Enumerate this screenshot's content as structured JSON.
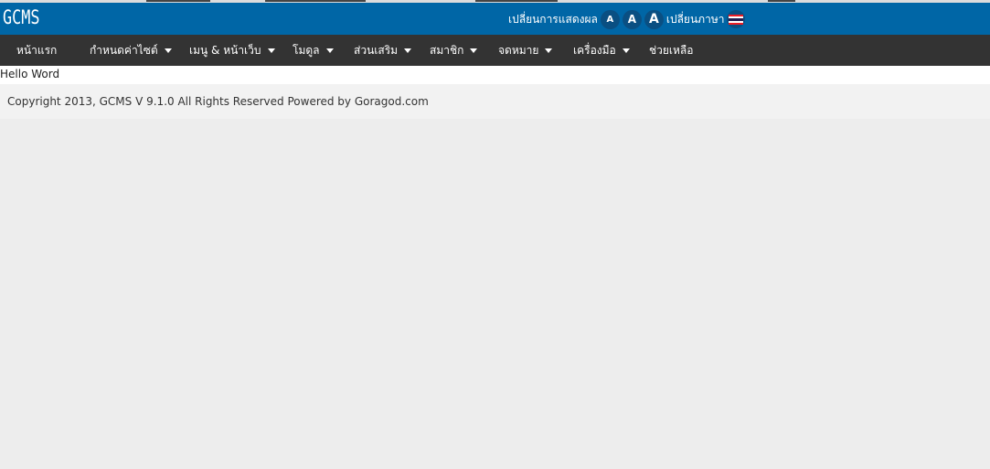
{
  "header": {
    "logo": "GCMS",
    "display_label": "เปลี่ยนการแสดงผล",
    "font_sizes": [
      "A",
      "A",
      "A"
    ],
    "language_label": "เปลี่ยนภาษา",
    "flag_icon": "thai-flag-icon",
    "colors": {
      "header_bg": "#0066a6",
      "nav_bg": "#333333"
    }
  },
  "nav": {
    "items": [
      {
        "label": "หน้าแรก",
        "dropdown": false
      },
      {
        "label": "กำหนดค่าไซต์",
        "dropdown": true
      },
      {
        "label": "เมนู & หน้าเว็บ",
        "dropdown": true
      },
      {
        "label": "โมดูล",
        "dropdown": true
      },
      {
        "label": "ส่วนเสริม",
        "dropdown": true
      },
      {
        "label": "สมาชิก",
        "dropdown": true
      },
      {
        "label": "จดหมาย",
        "dropdown": true
      },
      {
        "label": "เครื่องมือ",
        "dropdown": true
      },
      {
        "label": "ช่วยเหลือ",
        "dropdown": false
      }
    ]
  },
  "content": {
    "text": "Hello Word"
  },
  "footer": {
    "copyright": "Copyright 2013, GCMS V 9.1.0 All Rights Reserved Powered by Goragod.com"
  }
}
